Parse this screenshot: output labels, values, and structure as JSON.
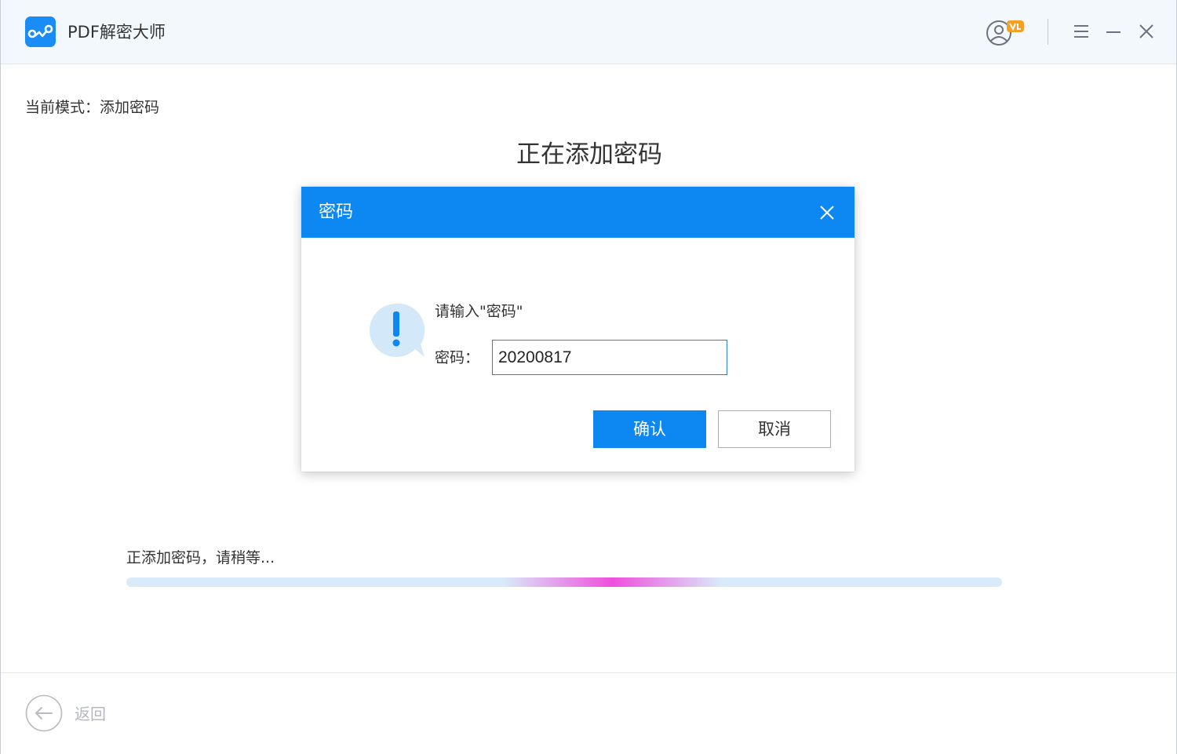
{
  "app": {
    "title": "PDF解密大师",
    "accent_color": "#0d87f2",
    "logo_icon": "chain-link-logo",
    "user_icon": "user-vip-icon",
    "window_controls": [
      "menu-icon",
      "minimize-icon",
      "close-icon"
    ]
  },
  "main": {
    "mode_text": "当前模式：添加密码",
    "heading": "正在添加密码"
  },
  "dialog": {
    "title": "密码",
    "close_icon": "close-icon",
    "alert_icon": "exclamation-speech-bubble-icon",
    "prompt": "请输入\"密码\"",
    "password_label": "密码：",
    "password_value": "20200817",
    "confirm_label": "确认",
    "cancel_label": "取消"
  },
  "progress": {
    "status_text": "正添加密码，请稍等...",
    "indicator": "indeterminate",
    "glow_color": "#f046dc",
    "track_color": "#d9ebf9"
  },
  "footer": {
    "back_icon": "arrow-left-circle-icon",
    "back_label": "返回"
  }
}
